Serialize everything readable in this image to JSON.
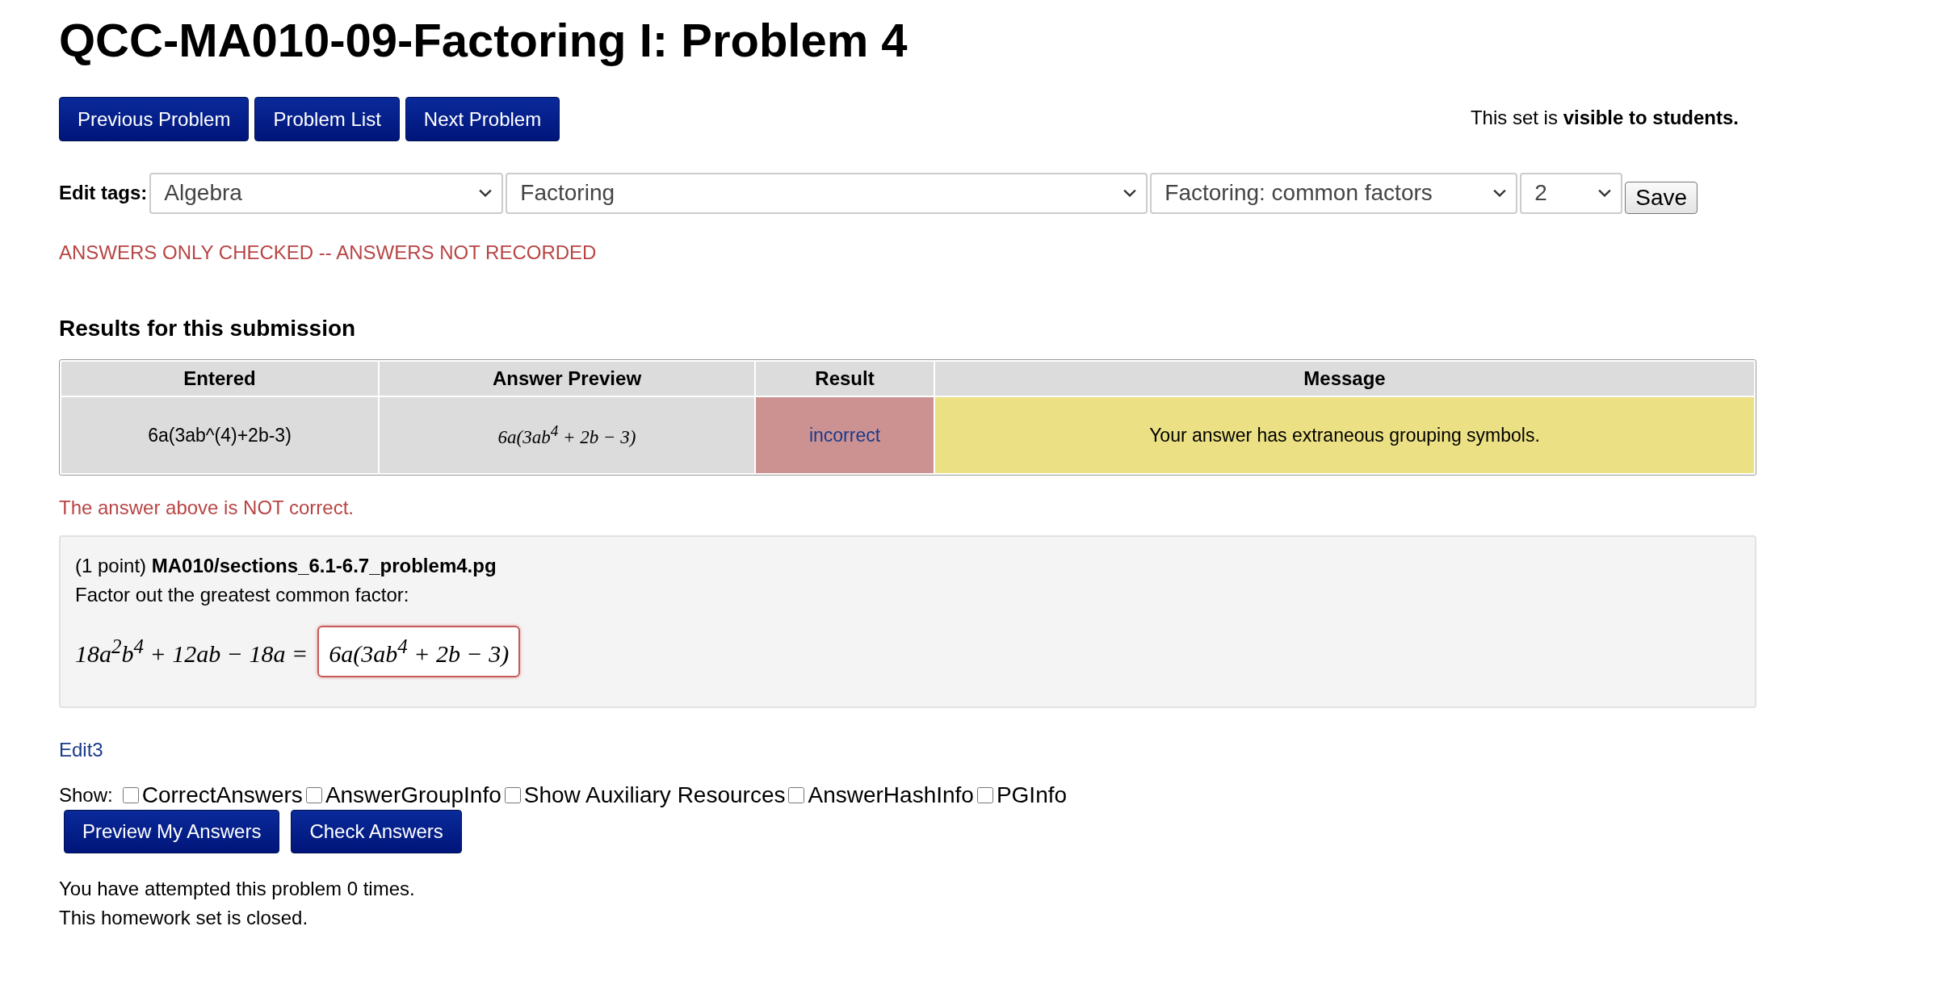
{
  "title": "QCC-MA010-09-Factoring I: Problem 4",
  "nav_buttons": [
    "Previous Problem",
    "Problem List",
    "Next Problem"
  ],
  "visibility": "This set is **visible to students.**",
  "tags": {
    "label": "Edit tags:",
    "selects": [
      {
        "value": "Algebra"
      },
      {
        "value": "Factoring"
      },
      {
        "value": "Factoring: common factors"
      },
      {
        "value": "2"
      }
    ],
    "save": "Save"
  },
  "notice": "ANSWERS ONLY CHECKED -- ANSWERS NOT RECORDED",
  "results": {
    "heading": "Results for this submission",
    "columns": [
      "Entered",
      "Answer Preview",
      "Result",
      "Message"
    ],
    "rows": [
      {
        "entered": "6a(3ab^(4)+2b-3)",
        "preview": "6a(3ab$^{4}$ + 2b − 3)",
        "result": "incorrect",
        "correct": false,
        "message": "Your answer has extraneous grouping symbols."
      }
    ]
  },
  "feedback": "The answer above is NOT correct.",
  "problem": {
    "header": "(1 point) **MA010/sections_6.1-6.7_problem4.pg**",
    "prompt": "Factor out the greatest common factor:",
    "equation": "18a$^{2}$b$^{4}$ + 12ab − 18a =",
    "answer": {
      "value": "6a(3ab$^{4}$ + 2b − 3)",
      "correct": false
    }
  },
  "edit_link": "Edit3",
  "show": {
    "label": "Show:",
    "options": [
      {
        "label": "CorrectAnswers",
        "checked": false
      },
      {
        "label": "AnswerGroupInfo",
        "checked": false
      },
      {
        "label": "Show Auxiliary Resources",
        "checked": false
      },
      {
        "label": "AnswerHashInfo",
        "checked": false
      },
      {
        "label": "PGInfo",
        "checked": false
      }
    ]
  },
  "action_buttons": [
    "Preview My Answers",
    "Check Answers"
  ],
  "status_lines": [
    "You have attempted this problem 0 times.",
    "This homework set is closed."
  ]
}
